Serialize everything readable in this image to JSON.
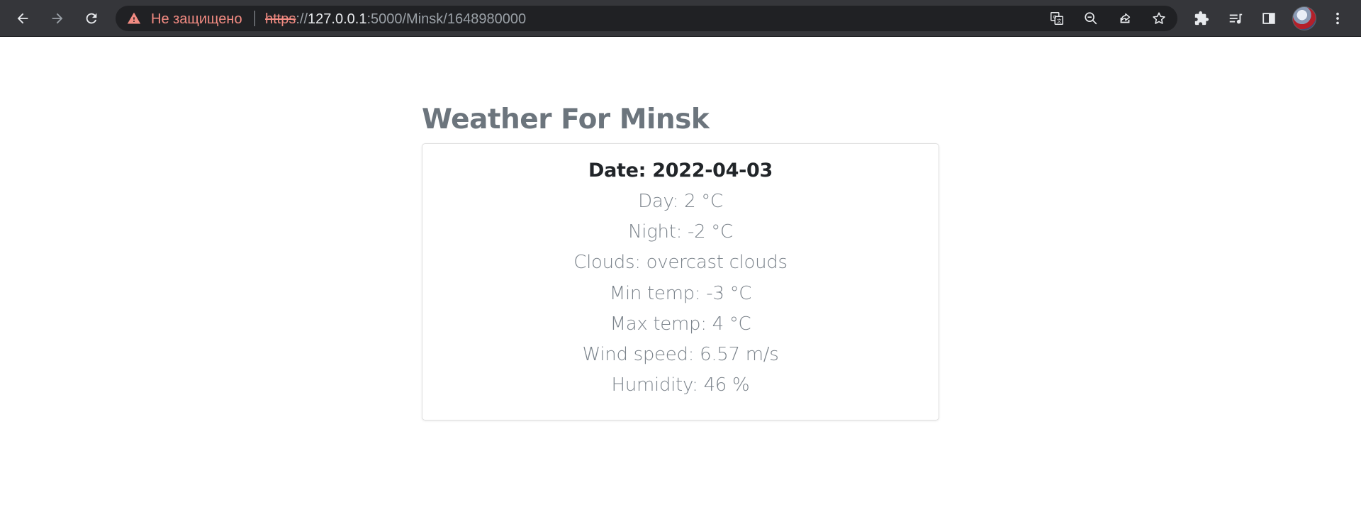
{
  "browser": {
    "not_secure_label": "Не защищено",
    "url": {
      "scheme": "https",
      "separator": "://",
      "host": "127.0.0.1",
      "path": ":5000/Minsk/1648980000"
    },
    "icons": [
      "back-icon",
      "forward-icon",
      "reload-icon",
      "translate-icon",
      "zoom-out-icon",
      "share-icon",
      "star-icon",
      "extensions-icon",
      "reading-list-icon",
      "side-panel-icon",
      "profile-avatar",
      "menu-icon"
    ],
    "colors": {
      "toolbar": "#35363a",
      "omnibox": "#202124",
      "warning": "#f28b82"
    }
  },
  "page": {
    "title": "Weather For Minsk",
    "card": {
      "date": "Date: 2022-04-03",
      "day": "Day: 2 °C",
      "night": "Night: -2 °C",
      "clouds": "Clouds: overcast clouds",
      "min_temp": "Min temp: -3 °C",
      "max_temp": "Max temp: 4 °C",
      "wind_speed": "Wind speed: 6.57 m/s",
      "humidity": "Humidity: 46 %"
    }
  }
}
